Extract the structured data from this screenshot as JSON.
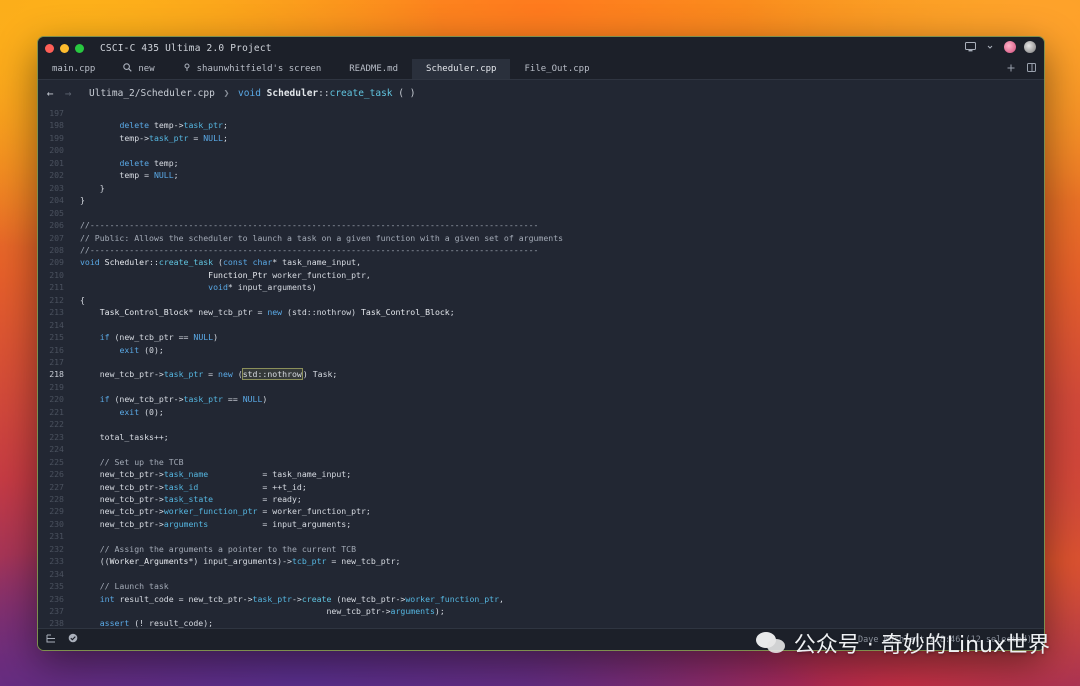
{
  "window": {
    "title": "CSCI-C 435 Ultima 2.0 Project"
  },
  "tabs": [
    {
      "label": "main.cpp",
      "icon": ""
    },
    {
      "label": "new",
      "icon": "search-icon"
    },
    {
      "label": "shaunwhitfield's screen",
      "icon": "screen-share-icon"
    },
    {
      "label": "README.md",
      "icon": ""
    },
    {
      "label": "Scheduler.cpp",
      "icon": "",
      "active": true
    },
    {
      "label": "File_Out.cpp",
      "icon": ""
    }
  ],
  "breadcrumb": {
    "path": "Ultima_2/Scheduler.cpp",
    "sep": "❯",
    "kw": "void",
    "cls": "Scheduler",
    "scope": "::",
    "fn": "create_task",
    "args": "( )"
  },
  "editor": {
    "current_line": "218",
    "lines": [
      {
        "n": "197",
        "t": ""
      },
      {
        "n": "198",
        "t": "        <k>delete</k> temp-><m>task_ptr</m>;"
      },
      {
        "n": "199",
        "t": "        temp-><m>task_ptr</m> = <k>NULL</k>;"
      },
      {
        "n": "200",
        "t": ""
      },
      {
        "n": "201",
        "t": "        <k>delete</k> temp;"
      },
      {
        "n": "202",
        "t": "        temp = <k>NULL</k>;"
      },
      {
        "n": "203",
        "t": "    }"
      },
      {
        "n": "204",
        "t": "}"
      },
      {
        "n": "205",
        "t": ""
      },
      {
        "n": "206",
        "t": "<c>//-------------------------------------------------------------------------------------------</c>"
      },
      {
        "n": "207",
        "t": "<c>// Public: Allows the scheduler to launch a task on a given function with a given set of arguments</c>"
      },
      {
        "n": "208",
        "t": "<c>//-------------------------------------------------------------------------------------------</c>"
      },
      {
        "n": "209",
        "t": "<k>void</k> <y>Scheduler</y>::<f>create_task</f> (<k>const</k> <k>char</k>* task_name_input,"
      },
      {
        "n": "210",
        "t": "                          <y>Function_Ptr</y> worker_function_ptr,"
      },
      {
        "n": "211",
        "t": "                          <k>void</k>* input_arguments)"
      },
      {
        "n": "212",
        "t": "{"
      },
      {
        "n": "213",
        "t": "    <y>Task_Control_Block</y>* new_tcb_ptr = <k>new</k> (std::nothrow) <y>Task_Control_Block</y>;"
      },
      {
        "n": "214",
        "t": ""
      },
      {
        "n": "215",
        "t": "    <k>if</k> (new_tcb_ptr == <k>NULL</k>)"
      },
      {
        "n": "216",
        "t": "        <k>exit</k> (0);"
      },
      {
        "n": "217",
        "t": ""
      },
      {
        "n": "218",
        "t": "    new_tcb_ptr-><m>task_ptr</m> = <k>new</k> (<h>std::nothrow</h>) Task;"
      },
      {
        "n": "219",
        "t": ""
      },
      {
        "n": "220",
        "t": "    <k>if</k> (new_tcb_ptr-><m>task_ptr</m> == <k>NULL</k>)"
      },
      {
        "n": "221",
        "t": "        <k>exit</k> (0);"
      },
      {
        "n": "222",
        "t": ""
      },
      {
        "n": "223",
        "t": "    total_tasks++;"
      },
      {
        "n": "224",
        "t": ""
      },
      {
        "n": "225",
        "t": "    <c>// Set up the TCB</c>"
      },
      {
        "n": "226",
        "t": "    new_tcb_ptr-><m>task_name</m>           = task_name_input;"
      },
      {
        "n": "227",
        "t": "    new_tcb_ptr-><m>task_id</m>             = ++t_id;"
      },
      {
        "n": "228",
        "t": "    new_tcb_ptr-><m>task_state</m>          = ready;"
      },
      {
        "n": "229",
        "t": "    new_tcb_ptr-><m>worker_function_ptr</m> = worker_function_ptr;"
      },
      {
        "n": "230",
        "t": "    new_tcb_ptr-><m>arguments</m>           = input_arguments;"
      },
      {
        "n": "231",
        "t": ""
      },
      {
        "n": "232",
        "t": "    <c>// Assign the arguments a pointer to the current TCB</c>"
      },
      {
        "n": "233",
        "t": "    ((<y>Worker_Arguments</y>*) input_arguments)-><m>tcb_ptr</m> = new_tcb_ptr;"
      },
      {
        "n": "234",
        "t": ""
      },
      {
        "n": "235",
        "t": "    <c>// Launch task</c>"
      },
      {
        "n": "236",
        "t": "    <k>int</k> result_code = new_tcb_ptr-><m>task_ptr</m>-><f>create</f> (new_tcb_ptr-><m>worker_function_ptr</m>,"
      },
      {
        "n": "237",
        "t": "                                                  new_tcb_ptr-><m>arguments</m>);"
      },
      {
        "n": "238",
        "t": "    <k>assert</k> (! result_code);"
      }
    ]
  },
  "status": {
    "right": "Dave Mushlatt  218:46 (12 selected)"
  },
  "watermark": {
    "text": "公众号 · 奇妙的Linux世界"
  }
}
